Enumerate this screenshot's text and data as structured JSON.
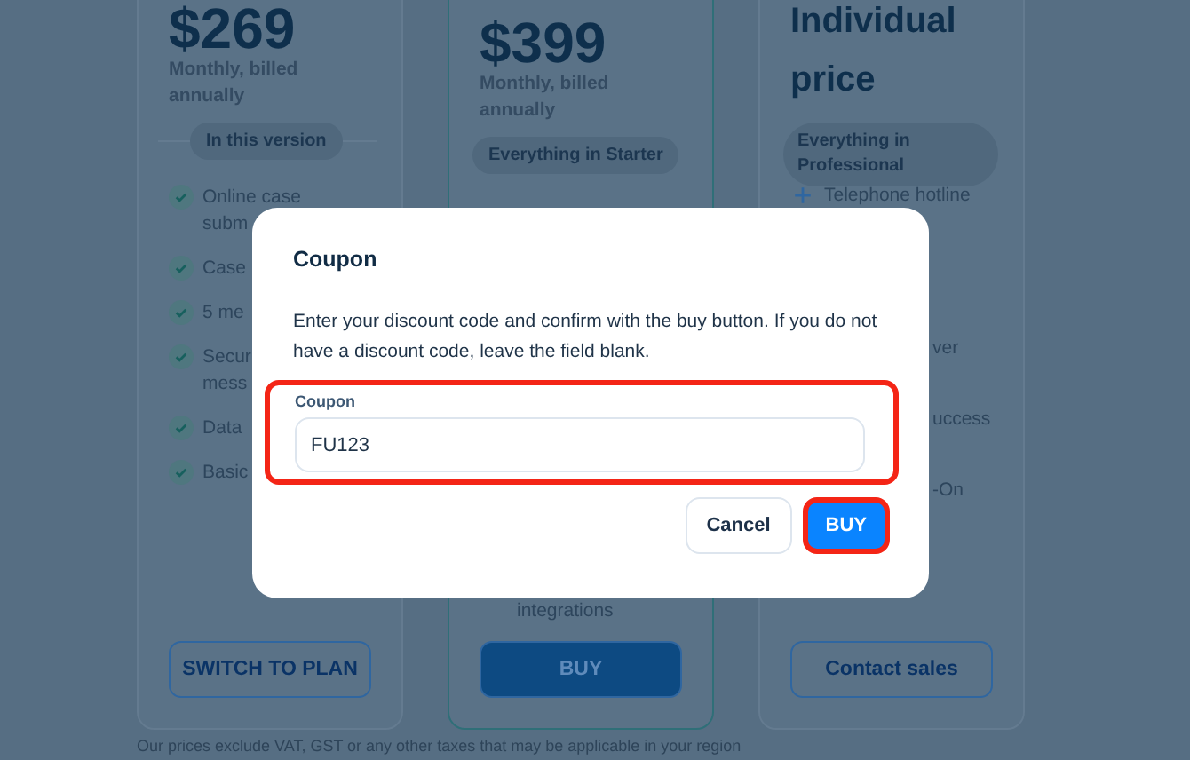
{
  "plans": [
    {
      "kind": "starter",
      "price": "$269",
      "billing": "Monthly, billed annually",
      "pill": "In this version",
      "features": [
        {
          "kind": "check",
          "text": "Online case\nsubm"
        },
        {
          "kind": "check",
          "text": "Case"
        },
        {
          "kind": "check",
          "text": "5 me"
        },
        {
          "kind": "check",
          "text": "Secur\nmess"
        },
        {
          "kind": "check",
          "text": "Data"
        },
        {
          "kind": "check",
          "text": "Basic"
        }
      ],
      "button": {
        "label": "SWITCH TO PLAN",
        "kind": "outline"
      }
    },
    {
      "kind": "featured",
      "price": "$399",
      "billing": "Monthly, billed annually",
      "pill": "Everything in Starter",
      "features": [
        {
          "kind": "bare",
          "text": "integrations"
        }
      ],
      "button": {
        "label": "BUY",
        "kind": "filled"
      }
    },
    {
      "kind": "custom",
      "price": "Individual price",
      "pill": "Everything in Professional",
      "features": [
        {
          "kind": "plus",
          "text": "Telephone hotline"
        },
        {
          "kind": "cut",
          "text": "ver"
        },
        {
          "kind": "cut",
          "text": "uccess"
        },
        {
          "kind": "cut",
          "text": "-On"
        }
      ],
      "button": {
        "label": "Contact sales",
        "kind": "outline"
      }
    }
  ],
  "footnote": "Our prices exclude VAT, GST or any other taxes that may be applicable in your region",
  "dialog": {
    "title": "Coupon",
    "message": "Enter your discount code and confirm with the buy button. If you do not have a discount code, leave the field blank.",
    "field": {
      "label": "Coupon",
      "value": "FU123",
      "highlighted": true
    },
    "buttons": [
      {
        "label": "Cancel",
        "kind": "secondary",
        "highlighted": false
      },
      {
        "label": "BUY",
        "kind": "primary",
        "highlighted": true
      }
    ]
  }
}
